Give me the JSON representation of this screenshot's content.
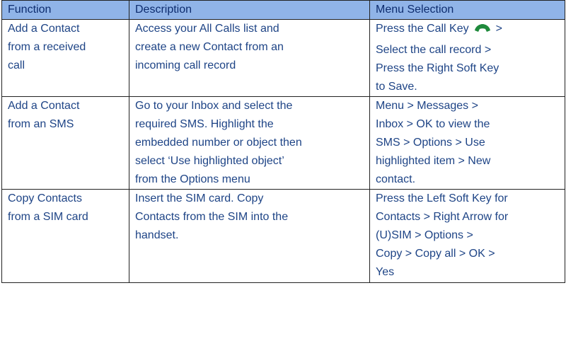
{
  "table": {
    "headers": {
      "function": "Function",
      "description": "Description",
      "menu_selection": "Menu Selection"
    },
    "rows": [
      {
        "function": "Add a Contact\nfrom a received\ncall",
        "description": "Access your All Calls list and\ncreate a new Contact from an\nincoming call record",
        "menu_selection_prefix": "Press the Call Key",
        "menu_selection_icon": "call-key-icon",
        "menu_selection_suffix": ">\nSelect the call record >\nPress the Right Soft Key\nto Save."
      },
      {
        "function": "Add a Contact\nfrom an SMS",
        "description": "Go to your Inbox and select the\nrequired SMS. Highlight the\nembedded number or object then\nselect ‘Use highlighted object’\nfrom the Options menu",
        "menu_selection": "Menu > Messages >\nInbox > OK to view the\nSMS > Options > Use\nhighlighted item > New\ncontact."
      },
      {
        "function": "Copy Contacts\nfrom a SIM card",
        "description": "Insert the SIM card. Copy\nContacts from the SIM into the\nhandset.",
        "menu_selection": "Press the Left Soft Key for\nContacts > Right Arrow for\n(U)SIM > Options >\nCopy > Copy all > OK >\nYes"
      }
    ]
  },
  "colors": {
    "header_background": "#90b4e8",
    "text": "#1e4486",
    "call_key_icon": "#1f8a3c"
  }
}
